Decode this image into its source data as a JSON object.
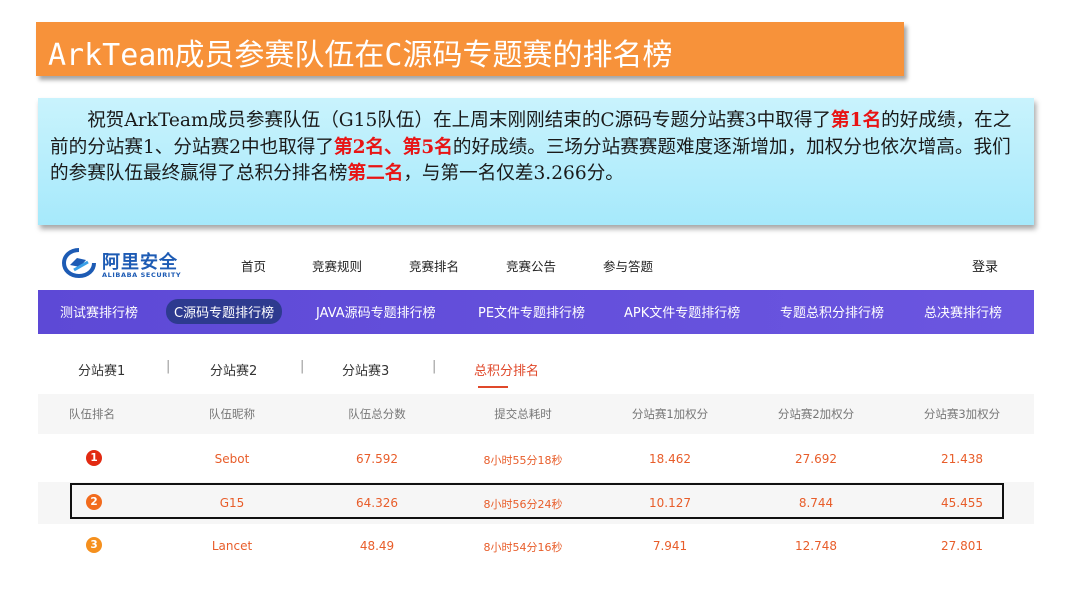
{
  "slide": {
    "title": "ArkTeam成员参赛队伍在C源码专题赛的排名榜",
    "paragraph": {
      "part1": "祝贺ArkTeam成员参赛队伍（G15队伍）在上周末刚刚结束的C源码专题分站赛3中取得了",
      "hl1": "第1名",
      "part2": "的好成绩，在之前的分站赛1、分站赛2中也取得了",
      "hl2": "第2名、第5名",
      "part3": "的好成绩。三场分站赛赛题难度逐渐增加，加权分也依次增高。我们的参赛队伍最终赢得了总积分排名榜",
      "hl3": "第二名",
      "part4": "，与第一名仅差3.266分。"
    },
    "colors": {
      "banner": "#f7923a",
      "highlight": "#e81414",
      "desc_bg": "#b5edfb"
    }
  },
  "site": {
    "logo": {
      "cn": "阿里安全",
      "en": "ALIBABA SECURITY",
      "icon": "alibaba-security-logo"
    },
    "nav": {
      "home": "首页",
      "rules": "竞赛规则",
      "ranking": "竞赛排名",
      "notice": "竞赛公告",
      "qa": "参与答题",
      "login": "登录"
    },
    "categories": [
      "测试赛排行榜",
      "C源码专题排行榜",
      "JAVA源码专题排行榜",
      "PE文件专题排行榜",
      "APK文件专题排行榜",
      "专题总积分排行榜",
      "总决赛排行榜"
    ],
    "active_category": "C源码专题排行榜",
    "subtabs": [
      "分站赛1",
      "分站赛2",
      "分站赛3",
      "总积分排名"
    ],
    "active_subtab": "总积分排名",
    "table": {
      "headers": [
        "队伍排名",
        "队伍昵称",
        "队伍总分数",
        "提交总耗时",
        "分站赛1加权分",
        "分站赛2加权分",
        "分站赛3加权分"
      ],
      "rows": [
        {
          "rank": "1",
          "name": "Sebot",
          "total": "67.592",
          "time": "8小时55分18秒",
          "s1": "18.462",
          "s2": "27.692",
          "s3": "21.438",
          "badge_color": "#e22a12"
        },
        {
          "rank": "2",
          "name": "G15",
          "total": "64.326",
          "time": "8小时56分24秒",
          "s1": "10.127",
          "s2": "8.744",
          "s3": "45.455",
          "badge_color": "#f26b1d"
        },
        {
          "rank": "3",
          "name": "Lancet",
          "total": "48.49",
          "time": "8小时54分16秒",
          "s1": "7.941",
          "s2": "12.748",
          "s3": "27.801",
          "badge_color": "#f5901e"
        }
      ]
    }
  }
}
